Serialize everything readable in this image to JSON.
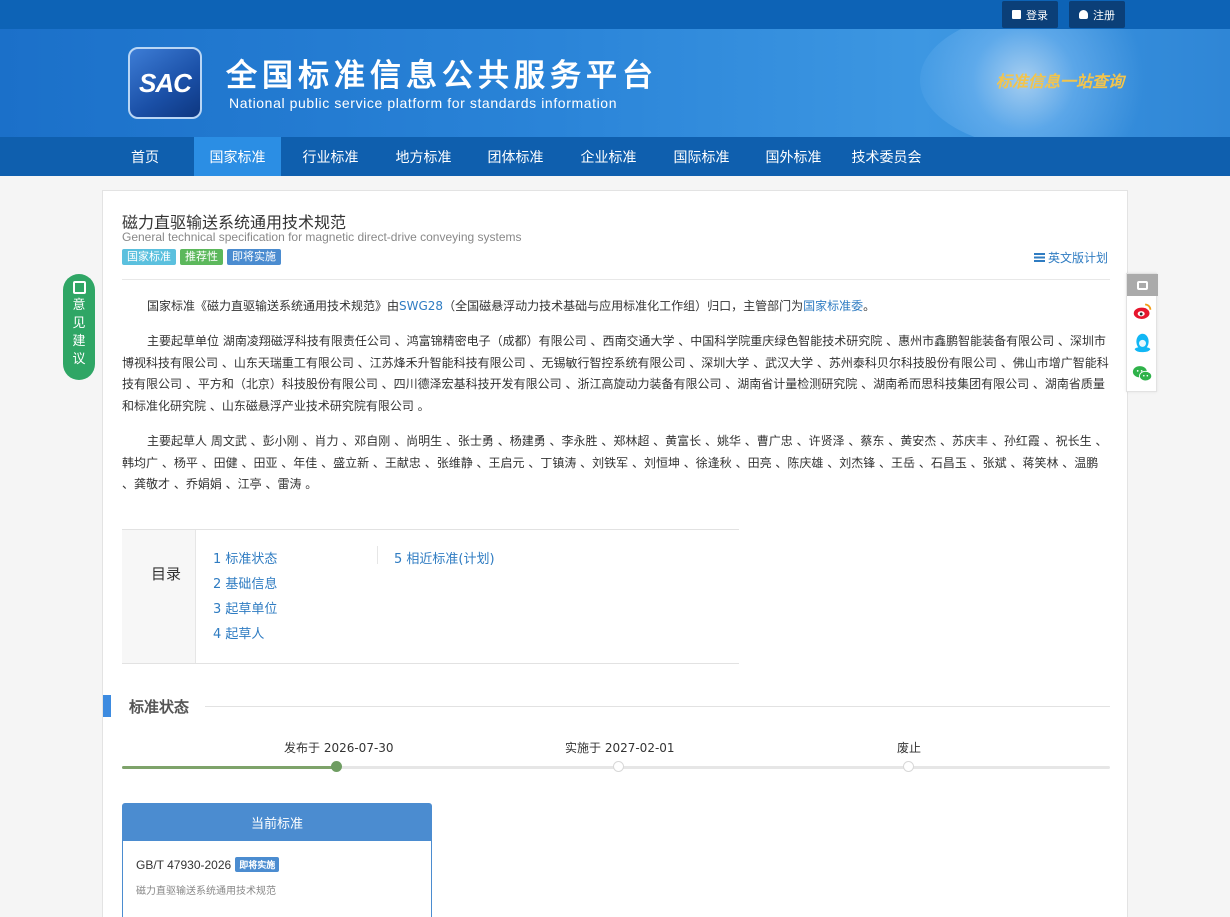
{
  "topbar": {
    "login_label": "登录",
    "register_label": "注册"
  },
  "header": {
    "logo_text": "SAC",
    "title": "全国标准信息公共服务平台",
    "subtitle": "National public service platform  for standards information",
    "slogan": "标准信息一站查询"
  },
  "nav": {
    "items": [
      "首页",
      "国家标准",
      "行业标准",
      "地方标准",
      "团体标准",
      "企业标准",
      "国际标准",
      "国外标准",
      "技术委员会"
    ],
    "active": "国家标准"
  },
  "standard": {
    "title": "磁力直驱输送系统通用技术规范",
    "title_en": "General technical specification for magnetic direct-drive conveying systems",
    "tags": [
      "国家标准",
      "推荐性",
      "即将实施"
    ],
    "en_plan_label": "英文版计划",
    "intro": {
      "prefix": "国家标准《磁力直驱输送系统通用技术规范》由",
      "committee_code": "SWG28",
      "middle": "（全国磁悬浮动力技术基础与应用标准化工作组）归口，主管部门为",
      "department": "国家标准委",
      "suffix": "。"
    },
    "drafting_units": "主要起草单位 湖南凌翔磁浮科技有限责任公司 、鸿富锦精密电子（成都）有限公司 、西南交通大学 、中国科学院重庆绿色智能技术研究院 、惠州市鑫鹏智能装备有限公司 、深圳市博视科技有限公司 、山东天瑞重工有限公司 、江苏烽禾升智能科技有限公司 、无锡敏行智控系统有限公司 、深圳大学 、武汉大学 、苏州泰科贝尔科技股份有限公司 、佛山市增广智能科技有限公司 、平方和（北京）科技股份有限公司 、四川德泽宏基科技开发有限公司 、浙江高旋动力装备有限公司 、湖南省计量检测研究院 、湖南希而思科技集团有限公司 、湖南省质量和标准化研究院 、山东磁悬浮产业技术研究院有限公司 。",
    "drafters": "主要起草人 周文武 、彭小刚 、肖力 、邓自刚 、尚明生 、张士勇 、杨建勇 、李永胜 、郑林超 、黄富长 、姚华 、曹广忠 、许贤泽 、蔡东 、黄安杰 、苏庆丰 、孙红霞 、祝长生 、韩均广 、杨平 、田健 、田亚 、年佳 、盛立新 、王献忠 、张维静 、王启元 、丁镇涛 、刘铁军 、刘恒坤 、徐逢秋 、田亮 、陈庆雄 、刘杰锋 、王岳 、石昌玉 、张斌 、蒋笑林 、温鹏 、龚敬才 、乔娟娟 、江亭 、雷涛 。"
  },
  "toc": {
    "label": "目录",
    "items": [
      "1  标准状态",
      "2  基础信息",
      "3  起草单位",
      "4  起草人",
      "5  相近标准(计划)"
    ]
  },
  "status_section": {
    "title": "标准状态",
    "timeline": [
      {
        "label": "发布于 2026-07-30",
        "done": true
      },
      {
        "label": "实施于 2027-02-01",
        "done": false
      },
      {
        "label": "废止",
        "done": false
      }
    ]
  },
  "current_standard": {
    "header": "当前标准",
    "code": "GB/T 47930-2026",
    "badge": "即将实施",
    "name": "磁力直驱输送系统通用技术规范"
  },
  "feedback": {
    "label": "意见建议"
  },
  "colors": {
    "header_blue": "#1b70c9",
    "nav_blue": "#0f5fae",
    "nav_active": "#2b8ee4",
    "link_blue": "#2f7cc2",
    "tag_national": "#5bc0de",
    "tag_recommended": "#5cb85c",
    "tag_upcoming": "#4b8cd0",
    "feedback_green": "#2fa665",
    "timeline_done": "#6f9d62"
  },
  "icons": [
    "lock-icon",
    "user-icon",
    "list-icon",
    "edit-icon",
    "share-icon",
    "weibo-icon",
    "qq-icon",
    "wechat-icon"
  ]
}
